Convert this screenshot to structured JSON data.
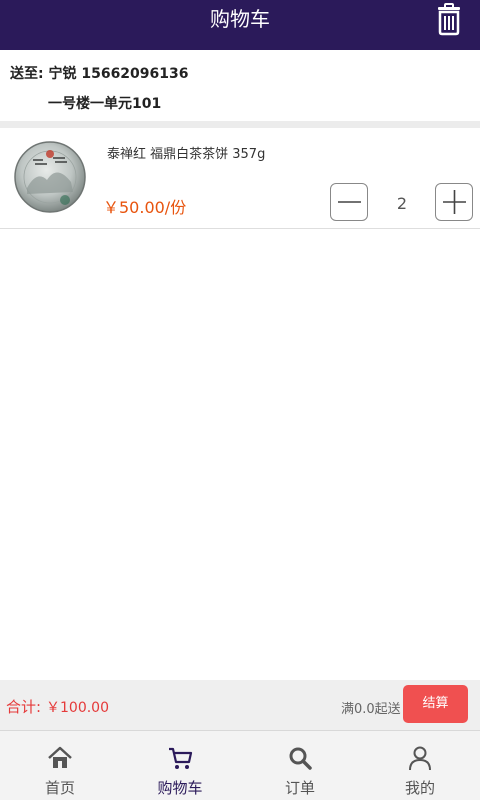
{
  "header": {
    "title": "购物车",
    "trash_icon": "trash-icon"
  },
  "address": {
    "line1": "送至: 宁锐 15662096136",
    "line2": "一号楼一单元101"
  },
  "cart_items": [
    {
      "name": "泰禅红 福鼎白茶茶饼 357g",
      "price": "￥50.00/份",
      "quantity": "2"
    }
  ],
  "summary": {
    "total_label": "合计:",
    "total_amount": "￥100.00",
    "min_order": "满0.0起送",
    "checkout_label": "结算"
  },
  "tabs": [
    {
      "label": "首页",
      "icon": "home-icon"
    },
    {
      "label": "购物车",
      "icon": "cart-icon",
      "active": true
    },
    {
      "label": "订单",
      "icon": "search-icon"
    },
    {
      "label": "我的",
      "icon": "user-icon"
    }
  ],
  "colors": {
    "header_bg": "#2b1a5a",
    "price": "#e8540e",
    "total": "#e53a3a",
    "checkout_bg": "#f05050"
  }
}
